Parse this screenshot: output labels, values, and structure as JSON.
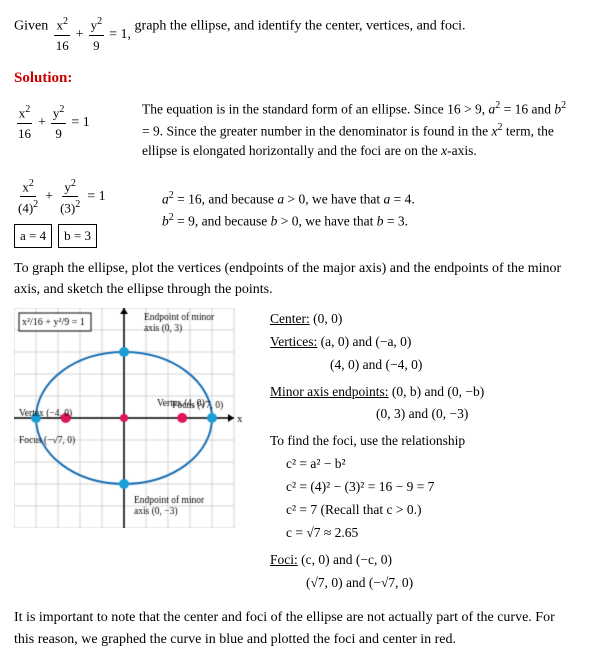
{
  "problem": {
    "label": "Given",
    "equation": "x²/16 + y²/9 = 1",
    "instruction": ", graph the ellipse, and identify the center, vertices, and foci."
  },
  "solution": {
    "label": "Solution:",
    "step1": {
      "equation": "x²/16 + y²/9 = 1",
      "description": "The equation is in the standard form of an ellipse. Since 16 > 9, a² = 16 and b² = 9. Since the greater number in the denominator is found in the x² term, the ellipse is elongated horizontally and the foci are on the x-axis."
    },
    "step2": {
      "a_eq": "a² = 16, and because a > 0, we have that a = 4.",
      "b_eq": "b² = 9, and because b > 0, we have that b = 3.",
      "box_a": "a = 4",
      "box_b": "b = 3"
    }
  },
  "graphing": {
    "intro": "To graph the ellipse, plot the vertices (endpoints of the major axis) and the endpoints of the minor axis, and sketch the ellipse through the points.",
    "info": {
      "center_label": "Center:",
      "center_val": "(0, 0)",
      "vertices_label": "Vertices:",
      "vertices_val1": "(a, 0) and (−a, 0)",
      "vertices_val2": "(4, 0) and (−4, 0)",
      "minor_label": "Minor axis endpoints:",
      "minor_val1": "(0, b) and (0, −b)",
      "minor_val2": "(0, 3) and (0, −3)",
      "foci_intro": "To find the foci, use the relationship",
      "foci_eq1": "c² = a² − b²",
      "foci_eq2": "c² = (4)² − (3)² = 16 − 9 = 7",
      "foci_eq3": "c² = 7    (Recall that c > 0.)",
      "foci_eq4": "c = √7 ≈ 2.65",
      "foci_label": "Foci:",
      "foci_val1": "(c, 0) and (−c, 0)",
      "foci_val2": "(√7, 0) and (−√7, 0)"
    },
    "graph_labels": {
      "eq_box": "x²/16 + y²/9 = 1",
      "top_minor": "Endpoint of minor axis (0, 3)",
      "vertex_left": "Vertex (−4, 0)",
      "vertex_right": "Vertex (4, 0)",
      "focus_right": "Focus (√7, 0)",
      "focus_left": "Focus (−√7, 0)",
      "bot_minor": "Endpoint of minor axis (0, −3)"
    }
  },
  "bottom_note": "It is important to note that the center and foci of the ellipse are not actually part of the curve. For this reason, we graphed the curve in blue and plotted the foci and center in red."
}
